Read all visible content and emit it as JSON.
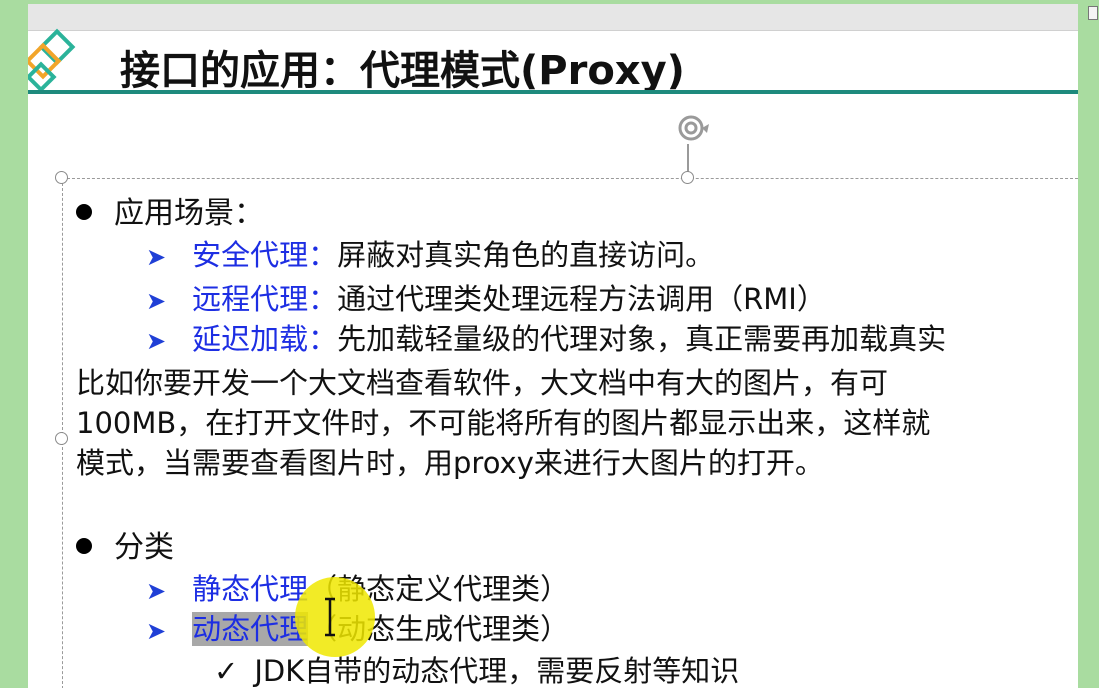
{
  "slide": {
    "title": "接口的应用：代理模式(Proxy)"
  },
  "section1": {
    "heading": "应用场景：",
    "items": [
      {
        "label": "安全代理：",
        "text": "屏蔽对真实角色的直接访问。"
      },
      {
        "label": "远程代理：",
        "text": "通过代理类处理远程方法调用（RMI）"
      },
      {
        "label": "延迟加载：",
        "text": "先加载轻量级的代理对象，真正需要再加载真实"
      }
    ],
    "paragraph": [
      "比如你要开发一个大文档查看软件，大文档中有大的图片，有可",
      "100MB，在打开文件时，不可能将所有的图片都显示出来，这样就",
      "模式，当需要查看图片时，用proxy来进行大图片的打开。"
    ]
  },
  "section2": {
    "heading": "分类",
    "items": [
      {
        "label": "静态代理",
        "text": "（静态定义代理类）"
      },
      {
        "label": "动态代理",
        "text": "（动态生成代理类）"
      }
    ],
    "check_item": "JDK自带的动态代理，需要反射等知识"
  },
  "icons": {
    "bullet": "bullet-dot",
    "sub_bullet": "arrow-bullet-icon",
    "check": "check-icon",
    "rotate": "rotate-handle-icon",
    "cursor": "ibeam-cursor-icon"
  },
  "colors": {
    "title_rule": "#1e8a7d",
    "blue_text": "#1d2ee3",
    "background": "#a9dca0",
    "highlight": "#f0e800"
  }
}
